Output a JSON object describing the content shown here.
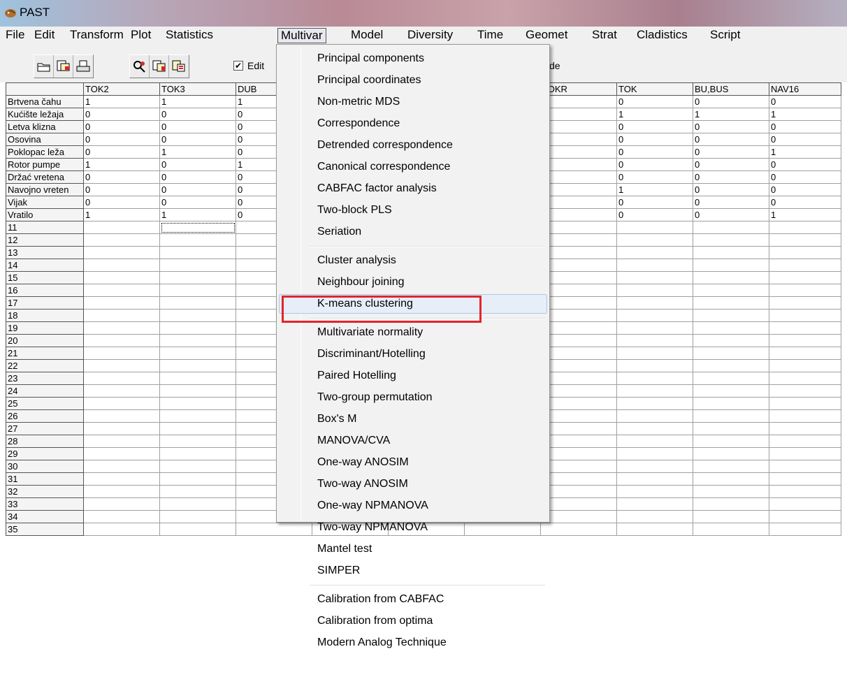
{
  "window": {
    "title": "PAST"
  },
  "menubar": [
    "File",
    "Edit",
    "Transform",
    "Plot",
    "Statistics",
    "Multivar",
    "Model",
    "Diversity",
    "Time",
    "Geomet",
    "Strat",
    "Cladistics",
    "Script"
  ],
  "menubar_active": "Multivar",
  "toolbar": {
    "edit_checkbox_label": "Edit",
    "edit_checked": true,
    "mode_label_fragment": "de"
  },
  "sheet": {
    "columns": [
      "",
      "TOK2",
      "TOK3",
      "DUB",
      "",
      "",
      "",
      "TOKR",
      "TOK",
      "BU,BUS",
      "NAV16"
    ],
    "rows": [
      [
        "Brtvena čahu",
        "1",
        "1",
        "1",
        "",
        "",
        "",
        "0",
        "0",
        "0",
        "0"
      ],
      [
        "Kućište ležaja",
        "0",
        "0",
        "0",
        "",
        "",
        "",
        "",
        "1",
        "1",
        "1"
      ],
      [
        "Letva klizna",
        "0",
        "0",
        "0",
        "",
        "",
        "",
        "0",
        "0",
        "0",
        "0"
      ],
      [
        "Osovina",
        "0",
        "0",
        "0",
        "",
        "",
        "",
        "0",
        "0",
        "0",
        "0"
      ],
      [
        "Poklopac leža",
        "0",
        "1",
        "0",
        "",
        "",
        "",
        "0",
        "0",
        "0",
        "1"
      ],
      [
        "Rotor pumpe",
        "1",
        "0",
        "1",
        "",
        "",
        "",
        "0",
        "0",
        "0",
        "0"
      ],
      [
        "Držać vretena",
        "0",
        "0",
        "0",
        "",
        "",
        "",
        "0",
        "0",
        "0",
        "0"
      ],
      [
        "Navojno vreten",
        "0",
        "0",
        "0",
        "",
        "",
        "",
        "0",
        "1",
        "0",
        "0"
      ],
      [
        "Vijak",
        "0",
        "0",
        "0",
        "",
        "",
        "",
        "0",
        "0",
        "0",
        "0"
      ],
      [
        "Vratilo",
        "1",
        "1",
        "0",
        "",
        "",
        "",
        "0",
        "0",
        "0",
        "1"
      ],
      [
        "11"
      ],
      [
        "12"
      ],
      [
        "13"
      ],
      [
        "14"
      ],
      [
        "15"
      ],
      [
        "16"
      ],
      [
        "17"
      ],
      [
        "18"
      ],
      [
        "19"
      ],
      [
        "20"
      ],
      [
        "21"
      ],
      [
        "22"
      ],
      [
        "23"
      ],
      [
        "24"
      ],
      [
        "25"
      ],
      [
        "26"
      ],
      [
        "27"
      ],
      [
        "28"
      ],
      [
        "29"
      ],
      [
        "30"
      ],
      [
        "31"
      ],
      [
        "32"
      ],
      [
        "33"
      ],
      [
        "34"
      ],
      [
        "35"
      ]
    ],
    "selected_cell": {
      "row": 11,
      "col": 2
    }
  },
  "multivar_menu": {
    "groups": [
      [
        "Principal components",
        "Principal coordinates",
        "Non-metric MDS",
        "Correspondence",
        "Detrended correspondence",
        "Canonical correspondence",
        "CABFAC factor analysis",
        "Two-block PLS",
        "Seriation"
      ],
      [
        "Cluster analysis",
        "Neighbour joining",
        "K-means clustering"
      ],
      [
        "Multivariate normality",
        "Discriminant/Hotelling",
        "Paired Hotelling",
        "Two-group permutation",
        "Box's M",
        "MANOVA/CVA",
        "One-way ANOSIM",
        "Two-way ANOSIM",
        "One-way NPMANOVA",
        "Two-way NPMANOVA",
        "Mantel test",
        "SIMPER"
      ],
      [
        "Calibration from CABFAC",
        "Calibration from optima",
        "Modern Analog Technique"
      ]
    ],
    "hovered_item": "K-means clustering"
  },
  "highlight_color": "#e3242b"
}
